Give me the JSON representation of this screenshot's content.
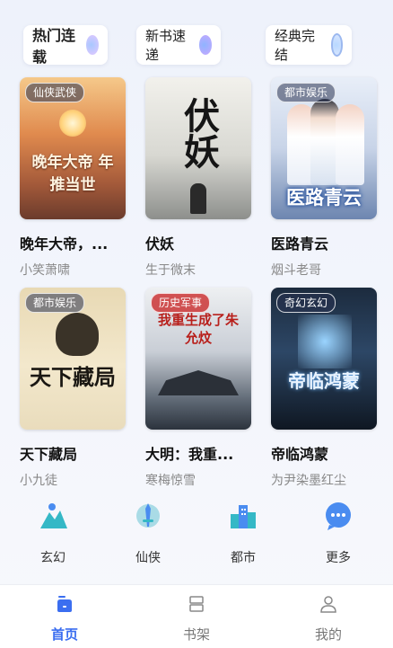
{
  "tabs": [
    {
      "label": "热门连载",
      "active": true
    },
    {
      "label": "新书速递",
      "active": false
    },
    {
      "label": "经典完结",
      "active": false
    }
  ],
  "books": [
    {
      "title": "晚年大帝，...",
      "author": "小笑萧啸",
      "badge": "仙侠武侠",
      "cover_text": "晚年大帝 年推当世"
    },
    {
      "title": "伏妖",
      "author": "生于微末",
      "badge": "",
      "cover_text": "伏妖"
    },
    {
      "title": "医路青云",
      "author": "烟斗老哥",
      "badge": "都市娱乐",
      "cover_text": "医路青云"
    },
    {
      "title": "天下藏局",
      "author": "小九徒",
      "badge": "都市娱乐",
      "cover_text": "天下藏局"
    },
    {
      "title": "大明：我重...",
      "author": "寒梅惊雪",
      "badge": "历史军事",
      "cover_text": "我重生成了朱允炆"
    },
    {
      "title": "帝临鸿蒙",
      "author": "为尹染墨红尘",
      "badge": "奇幻玄幻",
      "cover_text": "帝临鸿蒙"
    }
  ],
  "categories": [
    {
      "label": "玄幻",
      "icon": "mountain-icon"
    },
    {
      "label": "仙侠",
      "icon": "sword-icon"
    },
    {
      "label": "都市",
      "icon": "city-icon"
    },
    {
      "label": "更多",
      "icon": "more-chat-icon"
    }
  ],
  "nav": [
    {
      "label": "首页",
      "icon": "home-icon",
      "active": true
    },
    {
      "label": "书架",
      "icon": "bookshelf-icon",
      "active": false
    },
    {
      "label": "我的",
      "icon": "profile-icon",
      "active": false
    }
  ],
  "colors": {
    "accent": "#3b6ef0",
    "icon_teal": "#35b8c6",
    "icon_blue": "#4a8cf0"
  }
}
